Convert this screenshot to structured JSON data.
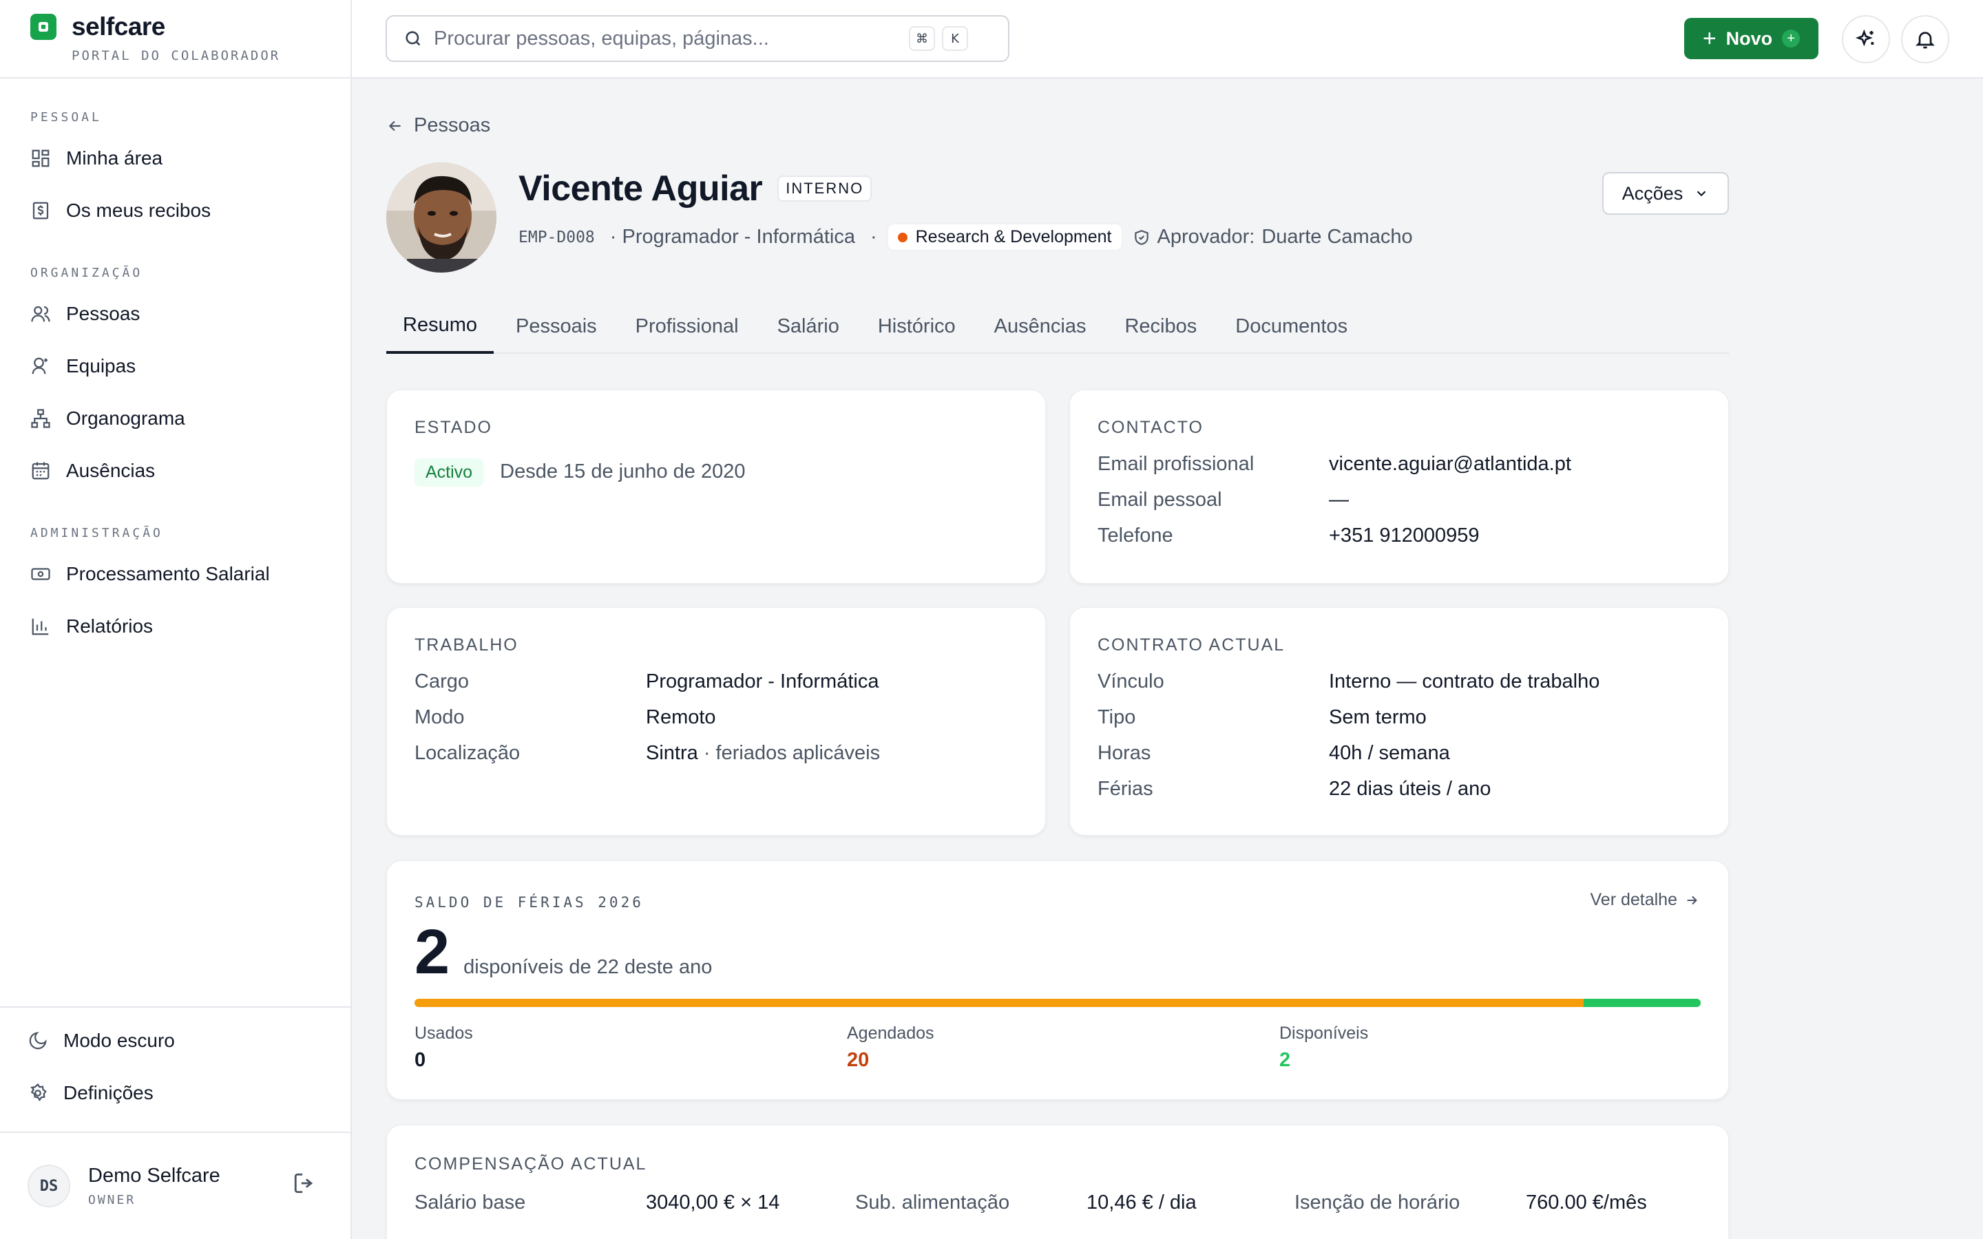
{
  "sidebar": {
    "brand": "selfcare",
    "subtitle": "PORTAL DO COLABORADOR",
    "sections": [
      {
        "label": "PESSOAL",
        "items": [
          {
            "label": "Minha área",
            "icon": "grid-icon"
          },
          {
            "label": "Os meus recibos",
            "icon": "receipt-icon"
          }
        ]
      },
      {
        "label": "ORGANIZAÇÃO",
        "items": [
          {
            "label": "Pessoas",
            "icon": "users-icon"
          },
          {
            "label": "Equipas",
            "icon": "team-icon"
          },
          {
            "label": "Organograma",
            "icon": "org-chart-icon"
          },
          {
            "label": "Ausências",
            "icon": "calendar-icon"
          }
        ]
      },
      {
        "label": "ADMINISTRAÇÃO",
        "items": [
          {
            "label": "Processamento Salarial",
            "icon": "money-icon"
          },
          {
            "label": "Relatórios",
            "icon": "bar-chart-icon"
          }
        ]
      }
    ],
    "bottom": [
      {
        "label": "Modo escuro",
        "icon": "moon-icon"
      },
      {
        "label": "Definições",
        "icon": "gear-icon"
      }
    ],
    "user": {
      "initials": "DS",
      "name": "Demo Selfcare",
      "role": "OWNER"
    }
  },
  "topbar": {
    "search_placeholder": "Procurar pessoas, equipas, páginas...",
    "shortcut": [
      "⌘",
      "K"
    ],
    "new_label": "Novo",
    "accent": "#15803d"
  },
  "breadcrumb": "Pessoas",
  "profile": {
    "name": "Vicente Aguiar",
    "tag": "INTERNO",
    "id": "EMP-D008",
    "role": "· Programador - Informática",
    "separator": "·",
    "department": "Research & Development",
    "department_color": "#ea580c",
    "approver_label": "Aprovador:",
    "approver_name": "Duarte Camacho",
    "actions_label": "Acções"
  },
  "tabs": [
    "Resumo",
    "Pessoais",
    "Profissional",
    "Salário",
    "Histórico",
    "Ausências",
    "Recibos",
    "Documentos"
  ],
  "estado": {
    "title": "ESTADO",
    "status": "Activo",
    "since": "Desde 15 de junho de 2020"
  },
  "contacto": {
    "title": "CONTACTO",
    "rows": [
      {
        "k": "Email profissional",
        "v": "vicente.aguiar@atlantida.pt"
      },
      {
        "k": "Email pessoal",
        "v": "—"
      },
      {
        "k": "Telefone",
        "v": "+351 912000959"
      }
    ]
  },
  "trabalho": {
    "title": "TRABALHO",
    "rows": [
      {
        "k": "Cargo",
        "v": "Programador - Informática",
        "extra": ""
      },
      {
        "k": "Modo",
        "v": "Remoto",
        "extra": ""
      },
      {
        "k": "Localização",
        "v": "Sintra",
        "extra": " · feriados aplicáveis"
      }
    ]
  },
  "contrato": {
    "title": "CONTRATO ACTUAL",
    "rows": [
      {
        "k": "Vínculo",
        "v": "Interno — contrato de trabalho"
      },
      {
        "k": "Tipo",
        "v": "Sem termo"
      },
      {
        "k": "Horas",
        "v": "40h / semana"
      },
      {
        "k": "Férias",
        "v": "22 dias úteis / ano"
      }
    ]
  },
  "ferias": {
    "title": "SALDO DE FÉRIAS 2026",
    "link": "Ver detalhe",
    "available": "2",
    "available_text": "disponíveis de 22 deste ano",
    "total": 22,
    "used": 0,
    "scheduled": 20,
    "free": 2,
    "labels": {
      "used": "Usados",
      "scheduled": "Agendados",
      "free": "Disponíveis"
    },
    "colors": {
      "used": "#111827",
      "scheduled": "#f59e0b",
      "scheduled_text": "#c2410c",
      "free": "#22c55e"
    }
  },
  "compensacao": {
    "title": "COMPENSAÇÃO ACTUAL",
    "rows": [
      {
        "k": "Salário base",
        "v": "3040,00 € × 14"
      },
      {
        "k": "Sub. alimentação",
        "v": "10,46 € / dia"
      },
      {
        "k": "Isenção de horário",
        "v": "760.00 €/mês"
      }
    ]
  }
}
